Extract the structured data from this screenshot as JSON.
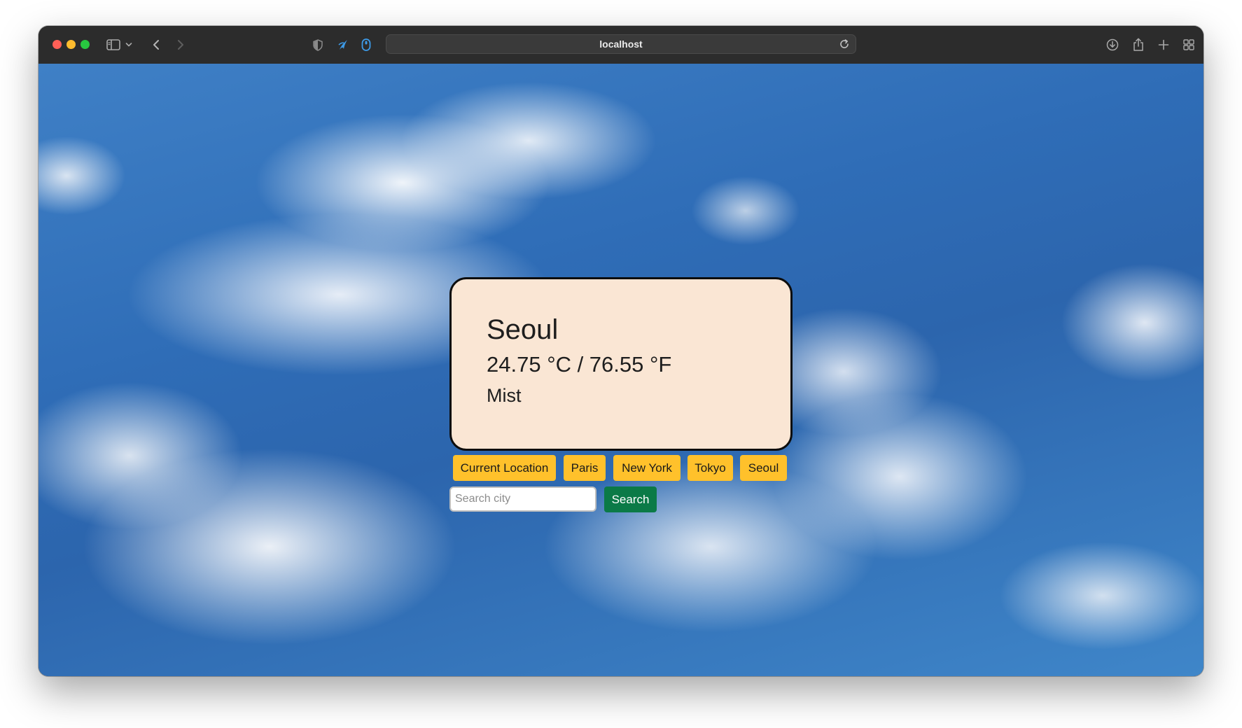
{
  "browser": {
    "address": "localhost",
    "icons": {
      "sidebar": "sidebar-icon",
      "sidebar_menu": "chevron-down-icon",
      "back": "back-icon",
      "forward": "forward-icon",
      "privacy": "privacy-shield-icon",
      "extension_1": "extension-icon",
      "extension_2": "extension-icon",
      "reload": "reload-icon",
      "download": "download-icon",
      "share": "share-icon",
      "new_tab": "plus-icon",
      "tab_overview": "tab-overview-icon"
    }
  },
  "weather": {
    "city": "Seoul",
    "temperature": "24.75 °C / 76.55 °F",
    "condition": "Mist"
  },
  "city_buttons": [
    "Current Location",
    "Paris",
    "New York",
    "Tokyo",
    "Seoul"
  ],
  "search": {
    "placeholder": "Search city",
    "value": "",
    "button_label": "Search"
  },
  "colors": {
    "card_background": "#fae6d4",
    "city_button": "#ffc12b",
    "search_button": "#0b7a47",
    "sky": "#2f6db7"
  }
}
